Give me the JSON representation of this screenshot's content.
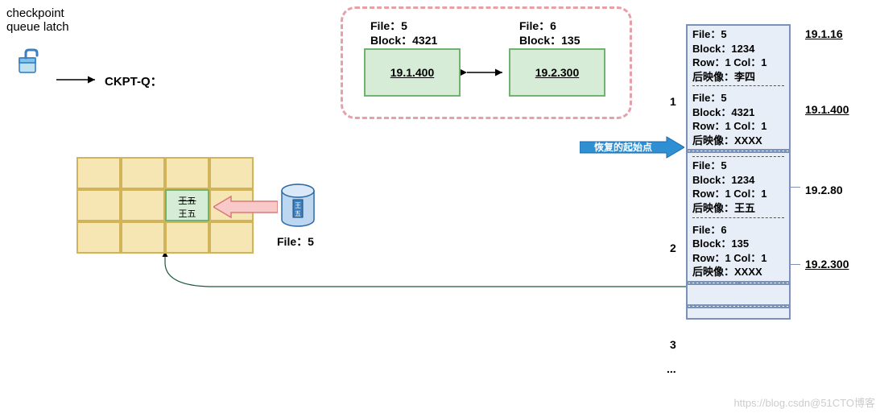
{
  "title": "checkpoint\nqueue latch",
  "ckpt_label": "CKPT-Q：",
  "dirty_blocks": [
    {
      "file_label": "File：5",
      "block_label": "Block：4321",
      "scn": "19.1.400"
    },
    {
      "file_label": "File：6",
      "block_label": "Block：135",
      "scn": "19.2.300"
    }
  ],
  "recover_label": "恢复的起始点",
  "file5_label": "File：5",
  "grid_cell_text_top": "王五",
  "grid_cell_text_bottom": "王五",
  "cyl_label": "王\n五",
  "log_entries": [
    {
      "idx": "1",
      "scn": "19.1.16",
      "lines": [
        "File：5",
        "Block：1234",
        "Row：1 Col：1",
        "后映像：李四"
      ]
    },
    {
      "idx": "",
      "scn": "19.1.400",
      "lines": [
        "File：5",
        "Block：4321",
        "Row：1 Col：1",
        "后映像：XXXX"
      ]
    },
    {
      "idx": "",
      "scn": "19.2.80",
      "lines": [
        "File：5",
        "Block：1234",
        "Row：1 Col：1",
        "后映像：王五"
      ]
    },
    {
      "idx": "2",
      "scn": "19.2.300",
      "lines": [
        "File：6",
        "Block：135",
        "Row：1 Col：1",
        "后映像：XXXX"
      ]
    }
  ],
  "idx3": "3",
  "idx_more": "...",
  "watermark": "https://blog.csdn@51CTO博客"
}
